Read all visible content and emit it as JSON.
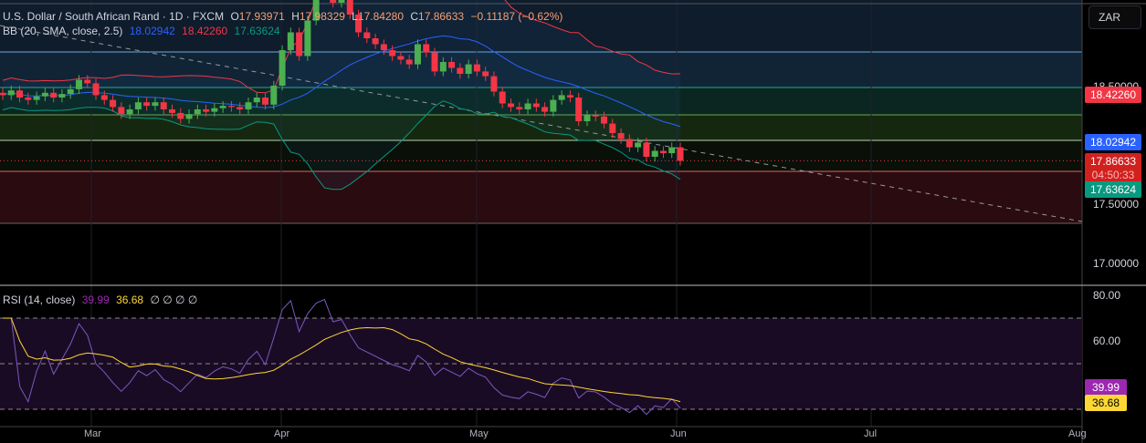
{
  "legend": {
    "symbol": "U.S. Dollar / South African Rand · 1D · FXCM",
    "o_label": "O",
    "open": "17.93971",
    "h_label": "H",
    "high": "17.98329",
    "l_label": "L",
    "low": "17.84280",
    "c_label": "C",
    "close": "17.86633",
    "change": "−0.11187 (−0.62%)",
    "bb_label": "BB (20, SMA, close, 2.5)",
    "bb_basis": "18.02942",
    "bb_upper": "18.42260",
    "bb_lower": "17.63624",
    "rsi_label": "RSI (14, close)",
    "rsi_value": "39.99",
    "rsi_ma": "36.68",
    "rsi_extra": "∅ ∅ ∅ ∅"
  },
  "currency_button": "ZAR",
  "price_axis": [
    "18.50000",
    "17.50000",
    "17.00000"
  ],
  "rsi_axis": [
    "80.00",
    "60.00"
  ],
  "tags": {
    "upper": "18.42260",
    "basis": "18.02942",
    "last": "17.86633",
    "countdown": "04:50:33",
    "lower": "17.63624",
    "rsi": "39.99",
    "rsi_ma": "36.68"
  },
  "dates": [
    "Mar",
    "Apr",
    "May",
    "Jun",
    "Jul",
    "Aug"
  ],
  "colors": {
    "up": "#26a69a",
    "up_body": "#4caf50",
    "down": "#f23645",
    "basis": "#2962ff",
    "upper": "#f23645",
    "lower": "#089981",
    "rsi": "#7e57c2",
    "rsi_ma": "#fdd835"
  },
  "chart_data": {
    "type": "candlestick",
    "closes": [
      18.42,
      18.46,
      18.4,
      18.38,
      18.41,
      18.44,
      18.4,
      18.43,
      18.47,
      18.55,
      18.52,
      18.42,
      18.38,
      18.32,
      18.26,
      18.3,
      18.36,
      18.33,
      18.36,
      18.3,
      18.27,
      18.22,
      18.26,
      18.3,
      18.28,
      18.31,
      18.33,
      18.32,
      18.3,
      18.36,
      18.4,
      18.34,
      18.5,
      18.8,
      18.95,
      18.75,
      19.05,
      19.3,
      19.4,
      19.2,
      19.25,
      19.1,
      18.95,
      18.9,
      18.85,
      18.8,
      18.75,
      18.72,
      18.68,
      18.85,
      18.78,
      18.62,
      18.7,
      18.65,
      18.6,
      18.68,
      18.62,
      18.58,
      18.45,
      18.35,
      18.32,
      18.3,
      18.35,
      18.32,
      18.28,
      18.38,
      18.42,
      18.4,
      18.2,
      18.25,
      18.24,
      18.18,
      18.1,
      18.05,
      17.98,
      18.02,
      17.9,
      17.95,
      17.93,
      17.98,
      17.86633
    ],
    "ylim": [
      16.85,
      19.25
    ],
    "rsi_ylim": [
      25,
      85
    ]
  }
}
